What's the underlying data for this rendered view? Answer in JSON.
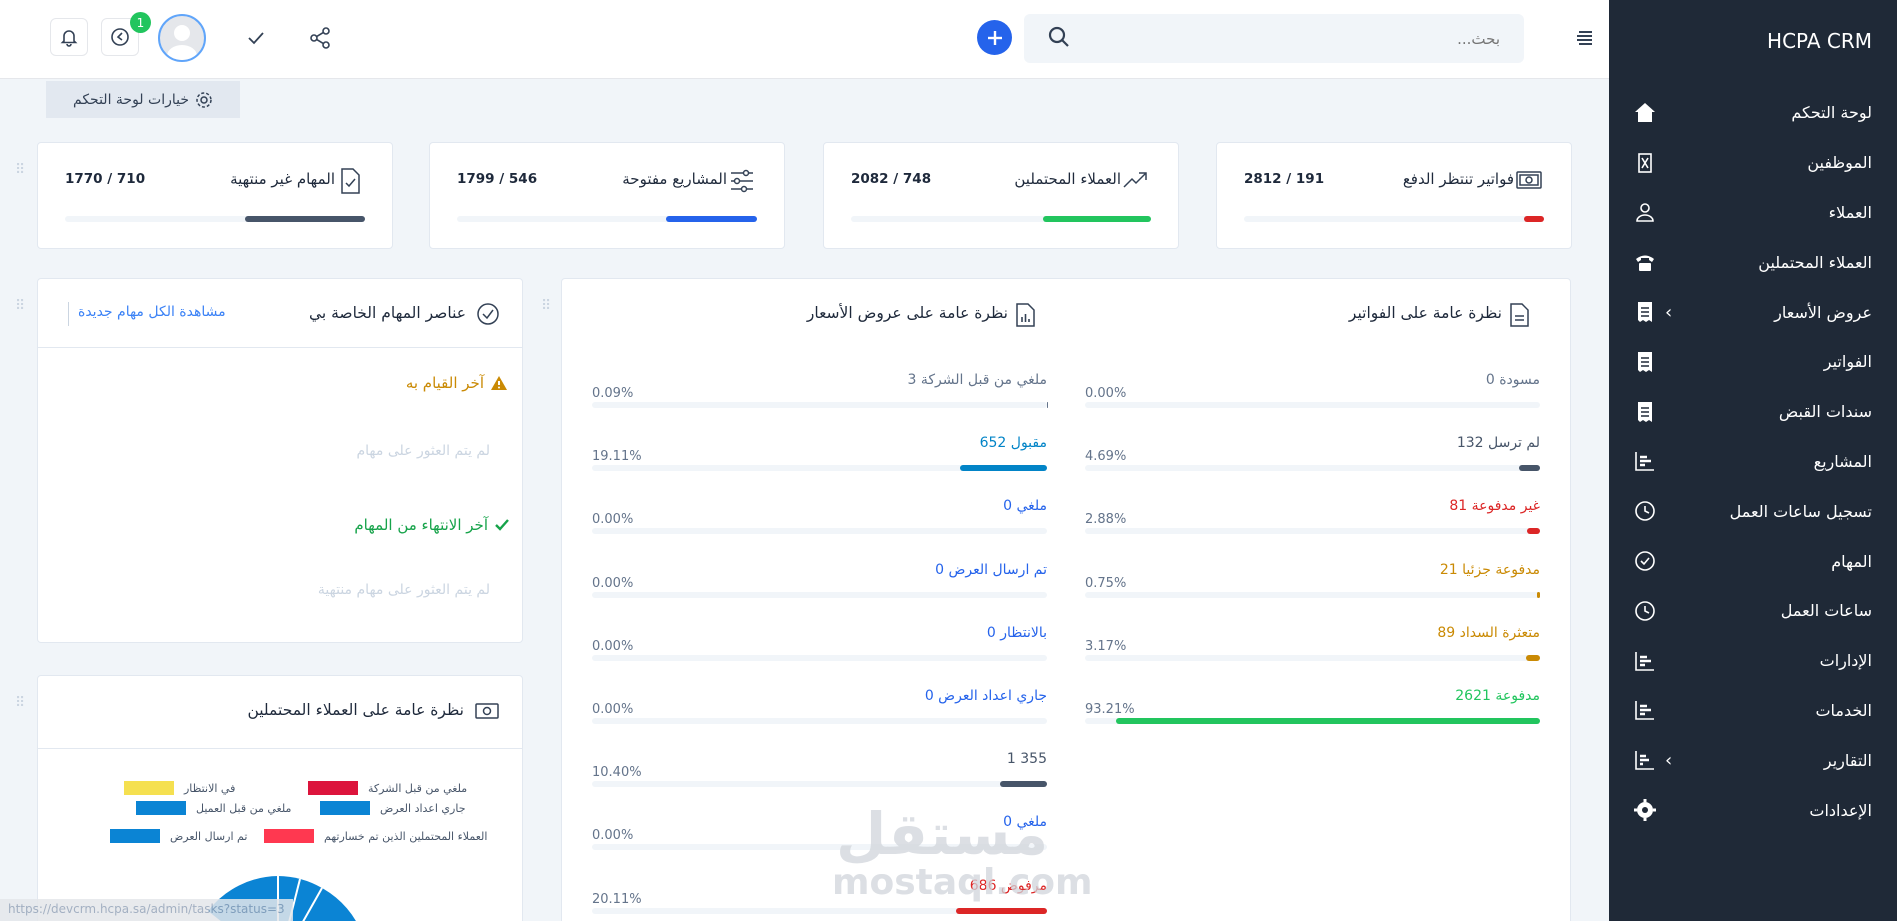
{
  "app": {
    "brand": "HCPA CRM"
  },
  "search": {
    "placeholder": "بحث..."
  },
  "topbar": {
    "notification_count": "1",
    "dashboard_options": "خيارات لوحة التحكم"
  },
  "sidebar": {
    "items": [
      {
        "label": "لوحة التحكم",
        "icon": "home-icon"
      },
      {
        "label": "الموظفين",
        "icon": "id-card-icon"
      },
      {
        "label": "العملاء",
        "icon": "user-icon"
      },
      {
        "label": "العملاء المحتملين",
        "icon": "phone-icon"
      },
      {
        "label": "عروض الأسعار",
        "icon": "receipt-icon",
        "expandable": true
      },
      {
        "label": "الفواتير",
        "icon": "receipt-icon"
      },
      {
        "label": "سندات القبض",
        "icon": "receipt-icon"
      },
      {
        "label": "المشاريع",
        "icon": "chart-icon"
      },
      {
        "label": "تسجيل ساعات العمل",
        "icon": "clock-icon"
      },
      {
        "label": "المهام",
        "icon": "check-circle-icon"
      },
      {
        "label": "ساعات العمل",
        "icon": "clock-icon"
      },
      {
        "label": "الإدارات",
        "icon": "chart-icon"
      },
      {
        "label": "الخدمات",
        "icon": "chart-icon"
      },
      {
        "label": "التقارير",
        "icon": "bar-chart-icon",
        "expandable": true
      },
      {
        "label": "الإعدادات",
        "icon": "gear-icon"
      }
    ]
  },
  "stats": [
    {
      "title": "فواتير تنتظر الدفع",
      "value": "2812 / 191",
      "fraction": 0.068,
      "color": "#dc2626",
      "icon": "money-icon"
    },
    {
      "title": "العملاء المحتملين",
      "value": "2082 / 748",
      "fraction": 0.359,
      "color": "#22c55e",
      "icon": "trend-up-icon"
    },
    {
      "title": "المشاريع مفتوحة",
      "value": "1799 / 546",
      "fraction": 0.304,
      "color": "#2563eb",
      "icon": "sliders-icon"
    },
    {
      "title": "المهام غير منتهية",
      "value": "1770 / 710",
      "fraction": 0.401,
      "color": "#475569",
      "icon": "file-check-icon"
    }
  ],
  "invoices": {
    "title": "نظرة عامة على الفواتير",
    "rows": [
      {
        "label": "0 مسودة",
        "pct": "0.00%",
        "fraction": 0.0,
        "color": "#64748b"
      },
      {
        "label": "132 لم ترسل",
        "pct": "4.69%",
        "fraction": 0.0469,
        "color": "#475569"
      },
      {
        "label": "81 غير مدفوعة",
        "pct": "2.88%",
        "fraction": 0.0288,
        "color": "#dc2626"
      },
      {
        "label": "21 مدفوعة جزئيا",
        "pct": "0.75%",
        "fraction": 0.0075,
        "color": "#ca8a04"
      },
      {
        "label": "89 متعثرة السداد",
        "pct": "3.17%",
        "fraction": 0.0317,
        "color": "#ca8a04"
      },
      {
        "label": "2621 مدفوعة",
        "pct": "93.21%",
        "fraction": 0.9321,
        "color": "#22c55e"
      }
    ]
  },
  "estimates": {
    "title": "نظرة عامة على عروض الأسعار",
    "rows": [
      {
        "label": "3 ملغي من قبل الشركة",
        "pct": "0.09%",
        "fraction": 0.0009,
        "color": "#64748b"
      },
      {
        "label": "652 مقبول",
        "pct": "19.11%",
        "fraction": 0.1911,
        "color": "#0284c7"
      },
      {
        "label": "0 ملغي",
        "pct": "0.00%",
        "fraction": 0.0,
        "color": "#2563eb"
      },
      {
        "label": "0 تم ارسال العرض",
        "pct": "0.00%",
        "fraction": 0.0,
        "color": "#2563eb"
      },
      {
        "label": "0 بالانتظار",
        "pct": "0.00%",
        "fraction": 0.0,
        "color": "#2563eb"
      },
      {
        "label": "0 جاري اعداد العرض",
        "pct": "0.00%",
        "fraction": 0.0,
        "color": "#2563eb"
      },
      {
        "label": "1 355",
        "pct": "10.40%",
        "fraction": 0.104,
        "color": "#475569"
      },
      {
        "label": "0 ملغي",
        "pct": "0.00%",
        "fraction": 0.0,
        "color": "#2563eb"
      },
      {
        "label": "686 مرفوض",
        "pct": "20.11%",
        "fraction": 0.2011,
        "color": "#dc2626"
      }
    ]
  },
  "tasks": {
    "title": "عناصر المهام الخاصة بي",
    "links": "مشاهدة الكل مهام جديدة",
    "latest_todo": "آخر القيام به",
    "no_tasks": "لم يتم العثور على مهام",
    "latest_done": "آخر الانتهاء من المهام",
    "no_done": "لم يتم العثور على مهام منتهية"
  },
  "leads": {
    "title": "نظرة عامة على العملاء المحتملين",
    "legend": [
      {
        "label": "ملغي من قبل الشركة",
        "color": "#dc143c"
      },
      {
        "label": "في الانتظار",
        "color": "#f5e050"
      },
      {
        "label": "جاري اعداد العرض",
        "color": "#0b84d4"
      },
      {
        "label": "ملغي من قبل العميل",
        "color": "#0b84d4"
      },
      {
        "label": "العملاء المحتملين الذين تم خسارتهم",
        "color": "#ff3850"
      },
      {
        "label": "تم ارسال العرض",
        "color": "#0b84d4"
      }
    ]
  },
  "statusbar": {
    "url": "https://devcrm.hcpa.sa/admin/tasks?status=3"
  },
  "watermark": {
    "ar": "مستقل",
    "en": "mostaql.com"
  }
}
